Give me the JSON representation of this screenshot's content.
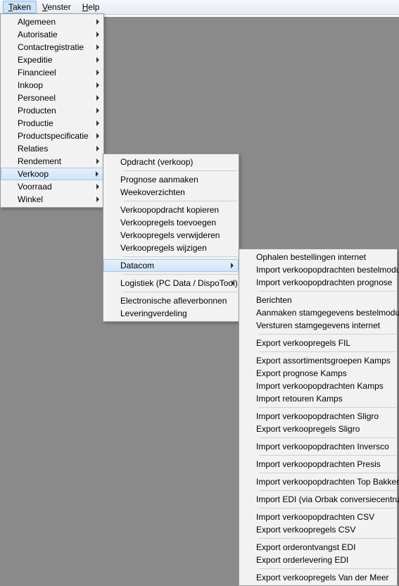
{
  "menubar": {
    "taken": {
      "u": "T",
      "rest": "aken"
    },
    "venster": {
      "u": "V",
      "rest": "enster"
    },
    "help": {
      "u": "H",
      "rest": "elp"
    }
  },
  "menu1": [
    {
      "label": "Algemeen",
      "sub": true
    },
    {
      "label": "Autorisatie",
      "sub": true
    },
    {
      "label": "Contactregistratie",
      "sub": true
    },
    {
      "label": "Expeditie",
      "sub": true
    },
    {
      "label": "Financieel",
      "sub": true
    },
    {
      "label": "Inkoop",
      "sub": true
    },
    {
      "label": "Personeel",
      "sub": true
    },
    {
      "label": "Producten",
      "sub": true
    },
    {
      "label": "Productie",
      "sub": true
    },
    {
      "label": "Productspecificatie",
      "sub": true
    },
    {
      "label": "Relaties",
      "sub": true
    },
    {
      "label": "Rendement",
      "sub": true
    },
    {
      "label": "Verkoop",
      "sub": true,
      "hi": true
    },
    {
      "label": "Voorraad",
      "sub": true
    },
    {
      "label": "Winkel",
      "sub": true
    }
  ],
  "menu2": [
    {
      "label": "Opdracht (verkoop)"
    },
    {
      "sep": true
    },
    {
      "label": "Prognose aanmaken"
    },
    {
      "label": "Weekoverzichten"
    },
    {
      "sep": true
    },
    {
      "label": "Verkoopopdracht kopieren"
    },
    {
      "label": "Verkoopregels toevoegen"
    },
    {
      "label": "Verkoopregels verwijderen"
    },
    {
      "label": "Verkoopregels wijzigen"
    },
    {
      "sep": true
    },
    {
      "label": "Datacom",
      "sub": true,
      "hi": true
    },
    {
      "sep": true
    },
    {
      "label": "Logistiek (PC Data / DispoTool)",
      "sub": true
    },
    {
      "sep": true
    },
    {
      "label": "Electronische afleverbonnen"
    },
    {
      "label": "Leveringverdeling"
    }
  ],
  "menu3": [
    {
      "label": "Ophalen bestellingen internet"
    },
    {
      "label": "Import verkoopopdrachten bestelmodule"
    },
    {
      "label": "Import verkoopopdrachten prognose"
    },
    {
      "sep": true
    },
    {
      "label": "Berichten"
    },
    {
      "label": "Aanmaken stamgegevens bestelmodule"
    },
    {
      "label": "Versturen stamgegevens internet"
    },
    {
      "sep": true
    },
    {
      "label": "Export verkoopregels FIL"
    },
    {
      "sep": true
    },
    {
      "label": "Export assortimentsgroepen Kamps"
    },
    {
      "label": "Export prognose Kamps"
    },
    {
      "label": "Import verkoopopdrachten Kamps"
    },
    {
      "label": "Import retouren Kamps"
    },
    {
      "sep": true
    },
    {
      "label": "Import verkoopopdrachten Sligro"
    },
    {
      "label": "Export verkoopregels Sligro"
    },
    {
      "sep": true
    },
    {
      "label": "Import verkoopopdrachten Inversco"
    },
    {
      "sep": true
    },
    {
      "label": "Import verkoopopdrachten Presis"
    },
    {
      "sep": true
    },
    {
      "label": "Import verkoopopdrachten Top Bakkers"
    },
    {
      "sep": true
    },
    {
      "label": "Import EDI (via Orbak conversiecentrum)"
    },
    {
      "sep": true
    },
    {
      "label": "Import verkoopopdrachten CSV"
    },
    {
      "label": "Export verkoopregels CSV"
    },
    {
      "sep": true
    },
    {
      "label": "Export orderontvangst EDI"
    },
    {
      "label": "Export orderlevering EDI"
    },
    {
      "sep": true
    },
    {
      "label": "Export verkoopregels Van der Meer"
    }
  ]
}
